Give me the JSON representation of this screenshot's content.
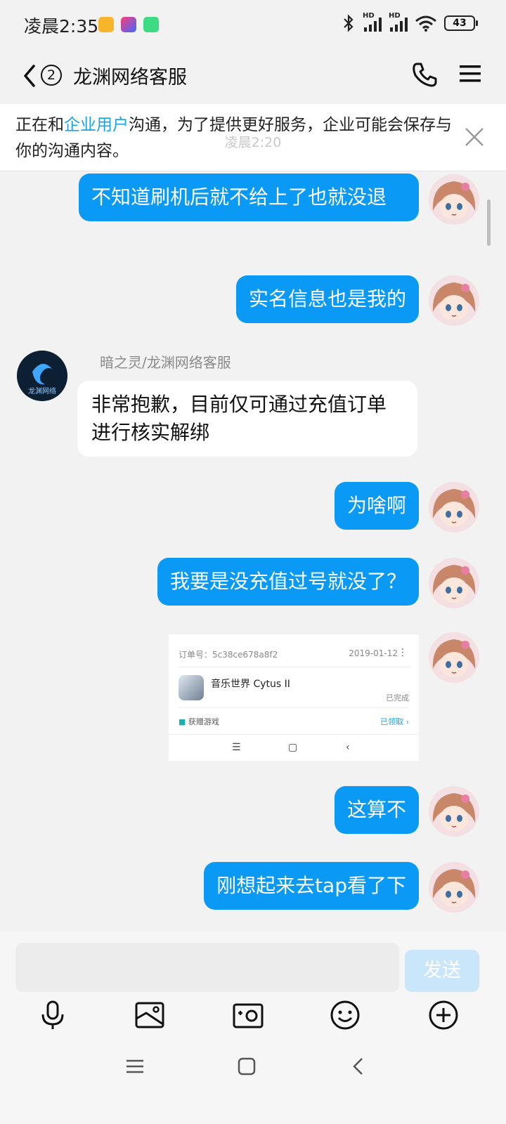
{
  "status_bar": {
    "time": "凌晨2:35",
    "battery": "43"
  },
  "header": {
    "unread_count": "2",
    "title": "龙渊网络客服"
  },
  "notice": {
    "prefix": "正在和",
    "highlight": "企业用户",
    "suffix": "沟通，为了提供更好服务，企业可能会保存与你的沟通内容。"
  },
  "chat": {
    "partial_timestamp": "凌晨2:20",
    "messages": [
      {
        "direction": "out",
        "text": "不知道刷机后就不给上了也就没退"
      },
      {
        "direction": "out",
        "text": "实名信息也是我的"
      },
      {
        "direction": "in",
        "sender": "暗之灵/龙渊网络客服",
        "avatar_text": "龙渊网络",
        "text": "非常抱歉，目前仅可通过充值订单进行核实解绑"
      },
      {
        "direction": "out",
        "text": "为啥啊"
      },
      {
        "direction": "out",
        "text": "我要是没充值过号就没了？"
      },
      {
        "direction": "out",
        "type": "image"
      },
      {
        "direction": "out",
        "text": "这算不"
      },
      {
        "direction": "out",
        "text": "刚想起来去tap看了下"
      }
    ],
    "order_shot": {
      "order_label": "订单号：5c38ce678a8f2",
      "date": "2019-01-12",
      "game": "音乐世界 Cytus II",
      "status": "已完成",
      "gift": "获赠游戏",
      "claimed": "已领取"
    }
  },
  "input": {
    "send_label": "发送"
  },
  "colors": {
    "bubble_out": "#0a99f4",
    "highlight": "#1ba1e6",
    "send_disabled": "#c9e6fb"
  }
}
